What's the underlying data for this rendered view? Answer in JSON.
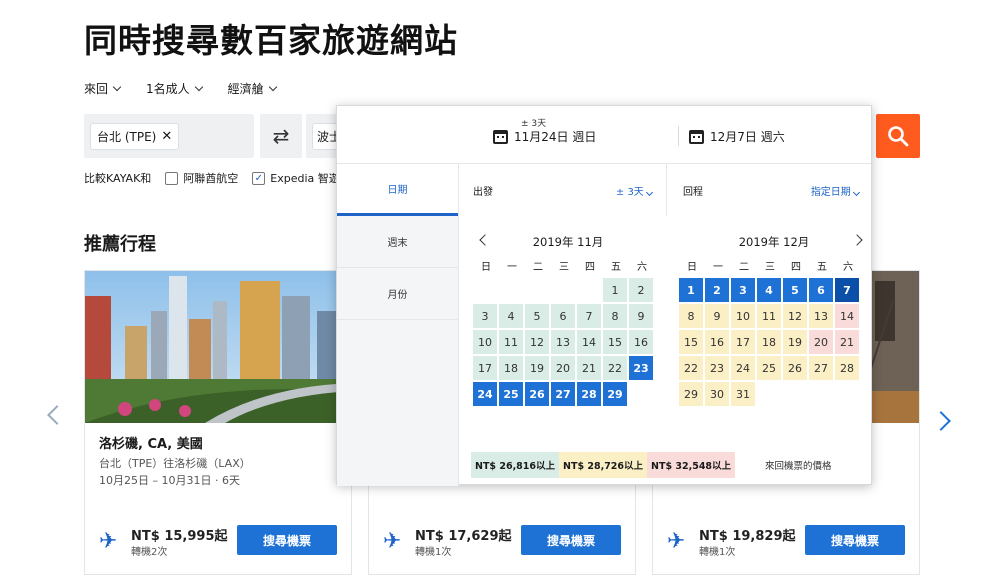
{
  "page": {
    "title": "同時搜尋數百家旅遊網站"
  },
  "options": {
    "trip_type": "來回",
    "travelers": "1名成人",
    "cabin": "經濟艙"
  },
  "search": {
    "origin": "台北 (TPE)",
    "destination_partial": "波士",
    "clear_glyph": "✕",
    "swap_glyph": "⇄"
  },
  "compare": {
    "label": "比較KAYAK和",
    "sites": [
      {
        "label": "阿聯酋航空",
        "checked": false
      },
      {
        "label": "Expedia 智遊網",
        "checked": true
      }
    ]
  },
  "section": {
    "title": "推薦行程"
  },
  "cards": [
    {
      "city": "洛杉磯, CA, 美國",
      "route": "台北（TPE）往洛杉磯（LAX）",
      "dates": "10月25日 – 10月31日 · 6天",
      "price": "NT$ 15,995起",
      "stops": "轉機2次",
      "button": "搜尋機票"
    },
    {
      "city": "",
      "route": "",
      "dates": "",
      "price": "NT$ 17,629起",
      "stops": "轉機1次",
      "button": "搜尋機票"
    },
    {
      "city": "",
      "route": "",
      "dates": "",
      "price": "NT$ 19,829起",
      "stops": "轉機1次",
      "button": "搜尋機票"
    }
  ],
  "calendar": {
    "flex_label": "± 3天",
    "depart_date": "11月24日 週日",
    "return_date": "12月7日 週六",
    "side_tabs": [
      "日期",
      "週末",
      "月份"
    ],
    "depart_label": "出發",
    "depart_flex": "± 3天",
    "return_label": "回程",
    "return_flex": "指定日期",
    "weekdays": [
      "日",
      "一",
      "二",
      "三",
      "四",
      "五",
      "六"
    ],
    "month1": {
      "title": "2019年 11月",
      "first_weekday": 5,
      "days": [
        "g",
        "g",
        "g",
        "g",
        "g",
        "g",
        "g",
        "g",
        "g",
        "g",
        "g",
        "g",
        "g",
        "g",
        "g",
        "g",
        "g",
        "g",
        "g",
        "g",
        "g",
        "g",
        "b",
        "b",
        "b",
        "b",
        "b",
        "b",
        "b"
      ]
    },
    "month2": {
      "title": "2019年 12月",
      "first_weekday": 0,
      "days": [
        "b",
        "b",
        "b",
        "b",
        "b",
        "b",
        "bd",
        "y",
        "y",
        "y",
        "y",
        "y",
        "y",
        "r",
        "y",
        "y",
        "y",
        "y",
        "y",
        "r",
        "r",
        "y",
        "y",
        "y",
        "y",
        "y",
        "y",
        "y",
        "y",
        "y",
        "y"
      ]
    },
    "legend": [
      {
        "label": "NT$ 26,816以上",
        "color": "#d9ece5"
      },
      {
        "label": "NT$ 28,726以上",
        "color": "#fbefc6"
      },
      {
        "label": "NT$ 32,548以上",
        "color": "#f9dcd9"
      }
    ],
    "legend_note": "來回機票的價格"
  }
}
